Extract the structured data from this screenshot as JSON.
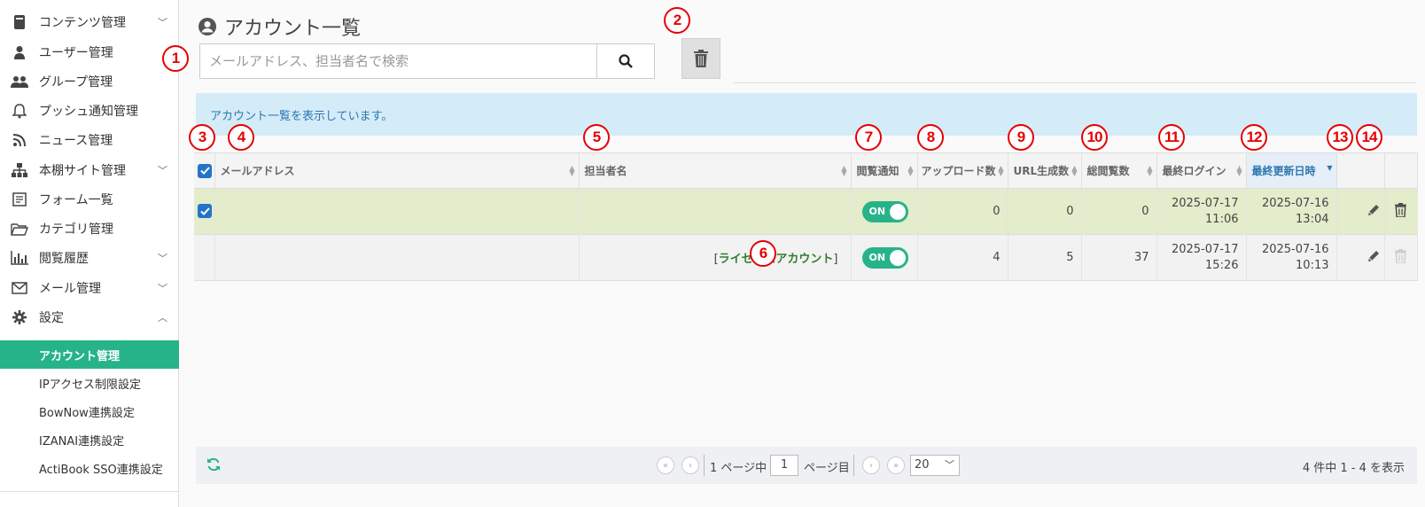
{
  "sidebar": {
    "items": [
      {
        "label": "コンテンツ管理",
        "icon": "book-icon",
        "chevron": "﹀"
      },
      {
        "label": "ユーザー管理",
        "icon": "user-icon",
        "chevron": ""
      },
      {
        "label": "グループ管理",
        "icon": "users-icon",
        "chevron": ""
      },
      {
        "label": "プッシュ通知管理",
        "icon": "bell-icon",
        "chevron": ""
      },
      {
        "label": "ニュース管理",
        "icon": "rss-icon",
        "chevron": ""
      },
      {
        "label": "本棚サイト管理",
        "icon": "sitemap-icon",
        "chevron": "﹀"
      },
      {
        "label": "フォーム一覧",
        "icon": "form-icon",
        "chevron": ""
      },
      {
        "label": "カテゴリ管理",
        "icon": "folder-icon",
        "chevron": ""
      },
      {
        "label": "閲覧履歴",
        "icon": "chart-icon",
        "chevron": "﹀"
      },
      {
        "label": "メール管理",
        "icon": "mail-icon",
        "chevron": "﹀"
      },
      {
        "label": "設定",
        "icon": "gear-icon",
        "chevron": "︿"
      }
    ],
    "subitems": [
      {
        "label": "アカウント管理",
        "active": true
      },
      {
        "label": "IPアクセス制限設定",
        "active": false
      },
      {
        "label": "BowNow連携設定",
        "active": false
      },
      {
        "label": "IZANAI連携設定",
        "active": false
      },
      {
        "label": "ActiBook SSO連携設定",
        "active": false
      }
    ]
  },
  "page": {
    "title": "アカウント一覧",
    "search_placeholder": "メールアドレス、担当者名で検索",
    "info_message": "アカウント一覧を表示しています。"
  },
  "annotations": [
    "1",
    "2",
    "3",
    "4",
    "5",
    "6",
    "7",
    "8",
    "9",
    "10",
    "11",
    "12",
    "13",
    "14"
  ],
  "table": {
    "headers": [
      "メールアドレス",
      "担当者名",
      "閲覧通知",
      "アップロード数",
      "URL生成数",
      "総閲覧数",
      "最終ログイン",
      "最終更新日時"
    ],
    "rows": [
      {
        "checked": true,
        "email": "",
        "person": "",
        "notify": "ON",
        "uploads": "0",
        "urls": "0",
        "views": "0",
        "last_login_date": "2025-07-17",
        "last_login_time": "11:06",
        "updated_date": "2025-07-16",
        "updated_time": "13:04"
      },
      {
        "checked": false,
        "email": "",
        "person_prefix": "[",
        "person_link": "ライセンスアカウント",
        "person_suffix": "]",
        "notify": "ON",
        "uploads": "4",
        "urls": "5",
        "views": "37",
        "last_login_date": "2025-07-17",
        "last_login_time": "15:26",
        "updated_date": "2025-07-16",
        "updated_time": "10:13"
      }
    ]
  },
  "footer": {
    "page_prefix": "1 ページ中",
    "page_value": "1",
    "page_suffix": "ページ目",
    "per_page": "20",
    "summary": "4 件中 1 - 4 を表示"
  },
  "colors": {
    "accent": "#27b38a",
    "annotation": "#e60000",
    "link": "#2d77b0",
    "info_bg": "#d4ebf8"
  }
}
